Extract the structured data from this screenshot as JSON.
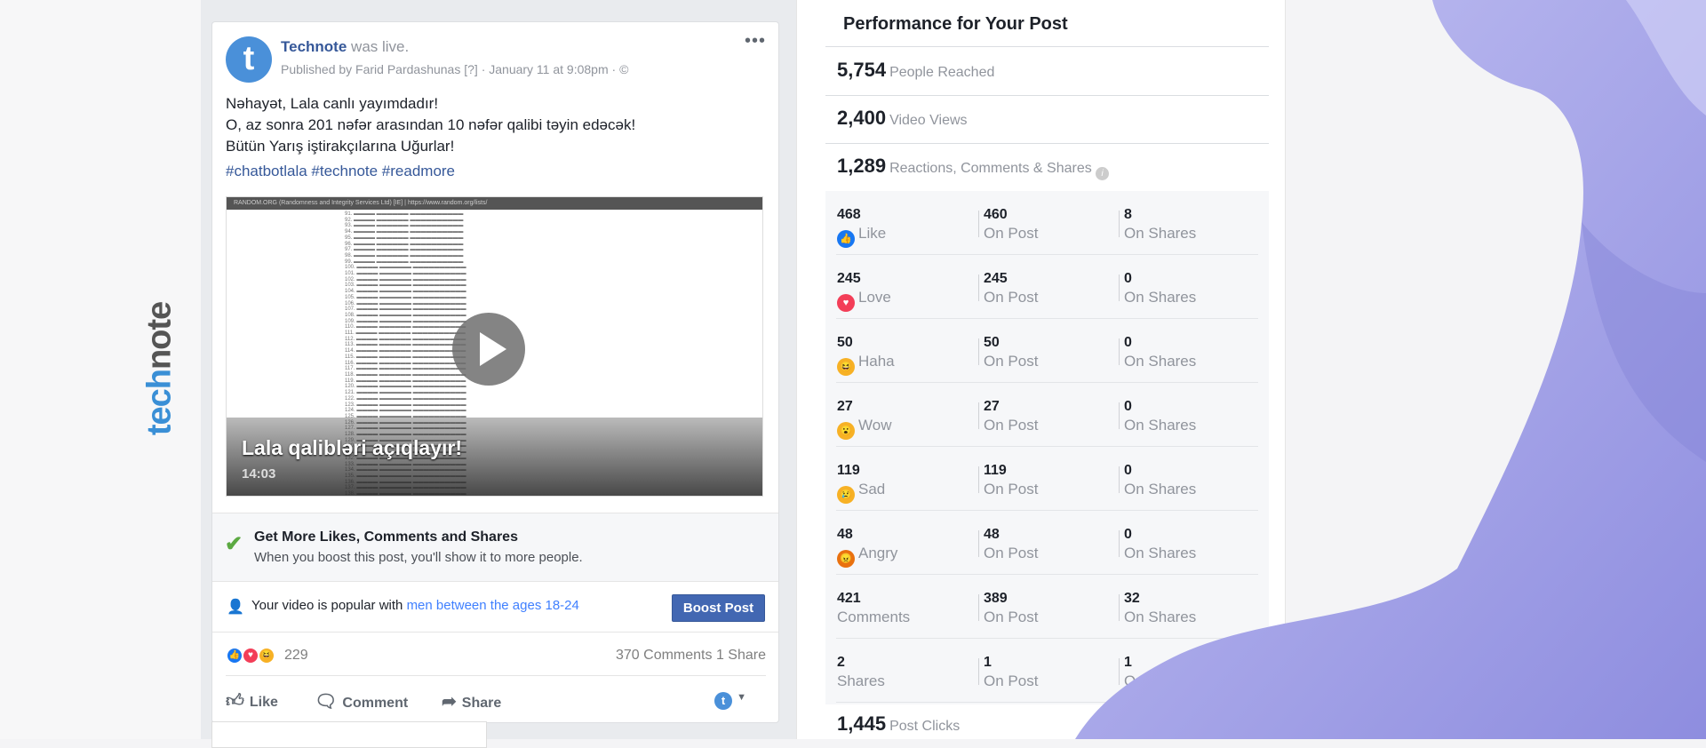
{
  "logo": {
    "part1": "tech",
    "part2": "note"
  },
  "post": {
    "page_name": "Technote",
    "action": "was live.",
    "avatar_letter": "t",
    "meta": "Published by Farid Pardashunas [?] · January 11 at 9:08pm · ©",
    "lines": [
      "Nəhayət, Lala canlı yayımdadır!",
      "O, az sonra 201 nəfər arasından 10 nəfər qalibi təyin edəcək!",
      "Bütün Yarış iştirakçılarına Uğurlar!"
    ],
    "hashtags": "#chatbotlala #technote #readmore",
    "video": {
      "browser_bar": "RANDOM.ORG (Randomness and Integrity Services Ltd) [IE] | https://www.random.org/lists/",
      "title": "Lala qalibləri açıqlayır!",
      "duration": "14:03"
    },
    "boost": {
      "heading": "Get More Likes, Comments and Shares",
      "sub": "When you boost this post, you'll show it to more people."
    },
    "popular": {
      "text": "Your video is popular with ",
      "link": "men between the ages 18-24",
      "button": "Boost Post"
    },
    "reactions": {
      "count": "229",
      "comments": "370 Comments",
      "shares": "1 Share"
    },
    "actions": {
      "like": "Like",
      "comment": "Comment",
      "share": "Share"
    }
  },
  "panel": {
    "title": "Performance for Your Post",
    "stats": [
      {
        "value": "5,754",
        "label": "People Reached"
      },
      {
        "value": "2,400",
        "label": "Video Views"
      },
      {
        "value": "1,289",
        "label": "Reactions, Comments & Shares"
      }
    ],
    "rows": [
      {
        "total": "468",
        "label": "Like",
        "emoji": "like",
        "on_post": "460",
        "on_shares": "8"
      },
      {
        "total": "245",
        "label": "Love",
        "emoji": "love",
        "on_post": "245",
        "on_shares": "0"
      },
      {
        "total": "50",
        "label": "Haha",
        "emoji": "haha",
        "on_post": "50",
        "on_shares": "0"
      },
      {
        "total": "27",
        "label": "Wow",
        "emoji": "wow",
        "on_post": "27",
        "on_shares": "0"
      },
      {
        "total": "119",
        "label": "Sad",
        "emoji": "sad",
        "on_post": "119",
        "on_shares": "0"
      },
      {
        "total": "48",
        "label": "Angry",
        "emoji": "angry",
        "on_post": "48",
        "on_shares": "0"
      },
      {
        "total": "421",
        "label": "Comments",
        "emoji": "",
        "on_post": "389",
        "on_shares": "32"
      },
      {
        "total": "2",
        "label": "Shares",
        "emoji": "",
        "on_post": "1",
        "on_shares": "1"
      }
    ],
    "on_post_label": "On Post",
    "on_shares_label": "On Shares",
    "clicks": {
      "value": "1,445",
      "label": "Post Clicks"
    }
  },
  "colors": {
    "accent": "#4267b2",
    "link": "#365899",
    "face": "#a9a8ec"
  }
}
